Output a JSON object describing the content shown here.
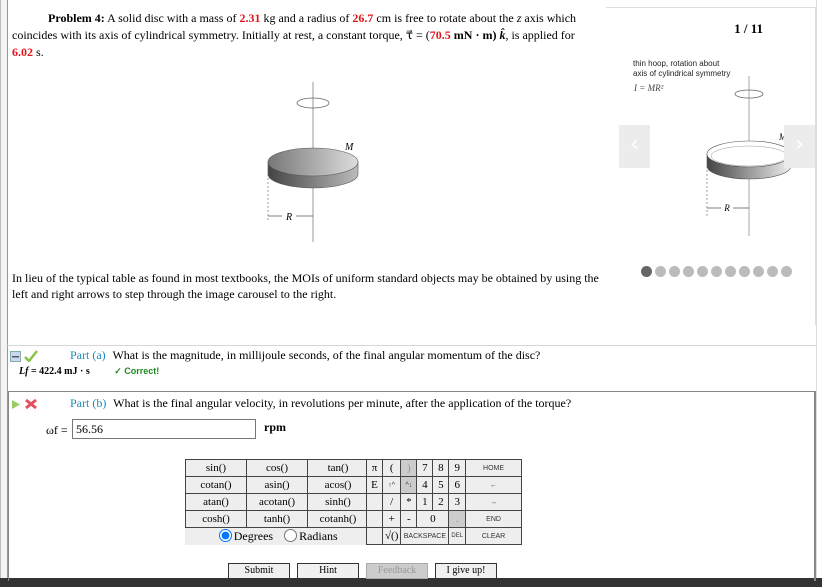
{
  "problem": {
    "label": "Problem 4:",
    "text_1": "A solid disc with a mass of",
    "mass": "2.31",
    "mass_unit": "kg and a radius of",
    "radius": "26.7",
    "text_2": "cm is free to rotate about the",
    "z": "z",
    "text_3": "axis which coincides with its axis of cylindrical symmetry. Initially at rest, a constant torque,",
    "tau": "τ⃗ = (",
    "torque": "70.5",
    "torque_unit": "mN · m)",
    "khat": "k̂",
    "text_4": ", is applied for",
    "time": "6.02",
    "time_unit": "s."
  },
  "figure": {
    "mass_label": "M",
    "radius_label": "R"
  },
  "carousel": {
    "counter": "1 / 11",
    "caption_1": "thin hoop, rotation about",
    "caption_2": "axis of cylindrical symmetry",
    "formula": "I = MR²",
    "prev": "‹",
    "next": "›",
    "mass_label": "M",
    "radius_label": "R",
    "total": 11,
    "active_index": 0
  },
  "moi_note": "In lieu of the typical table as found in most textbooks, the MOIs of uniform standard objects may be obtained by using the left and right arrows to step through the image carousel to the right.",
  "part_a": {
    "label": "Part (a)",
    "question": "What is the magnitude, in millijoule seconds, of the final angular momentum of the disc?",
    "answer_var": "Lf",
    "answer": "= 422.4 mJ · s",
    "status": "✓ Correct!",
    "status_color": "#1f8a1f"
  },
  "part_b": {
    "label": "Part (b)",
    "question": "What is the final angular velocity, in revolutions per minute, after the application of the torque?",
    "var": "ωf =",
    "input_value": "56.56",
    "unit": "rpm"
  },
  "fn_pad": [
    [
      "sin()",
      "cos()",
      "tan()"
    ],
    [
      "cotan()",
      "asin()",
      "acos()"
    ],
    [
      "atan()",
      "acotan()",
      "sinh()"
    ],
    [
      "cosh()",
      "tanh()",
      "cotanh()"
    ]
  ],
  "angle_mode": {
    "degrees": "Degrees",
    "radians": "Radians",
    "selected": "Degrees"
  },
  "key_pad": {
    "r0": [
      "π",
      "(",
      ")",
      "7",
      "8",
      "9",
      "HOME"
    ],
    "r1": [
      "E",
      "↑^",
      "^↓",
      "4",
      "5",
      "6",
      "←"
    ],
    "r2": [
      "",
      "/",
      "*",
      "1",
      "2",
      "3",
      "→"
    ],
    "r3": [
      "",
      "+",
      "-",
      "0",
      ".",
      "END"
    ],
    "r4": [
      "",
      "√()",
      "BACKSPACE",
      "DEL",
      "CLEAR"
    ]
  },
  "buttons": {
    "submit": "Submit",
    "hint": "Hint",
    "feedback": "Feedback",
    "give_up": "I give up!"
  },
  "colors": {
    "accent_red": "#e0151b",
    "part_blue": "#1b8ab8"
  }
}
